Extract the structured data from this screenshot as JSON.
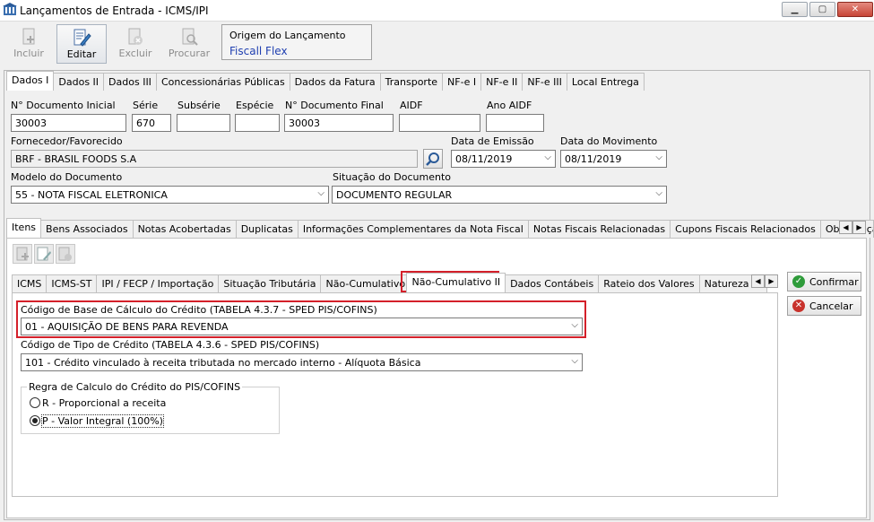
{
  "window": {
    "title": "Lançamentos de Entrada - ICMS/IPI"
  },
  "toolbar": {
    "incluir": "Incluir",
    "editar": "Editar",
    "excluir": "Excluir",
    "procurar": "Procurar"
  },
  "origem": {
    "label": "Origem do Lançamento",
    "value": "Fiscall Flex"
  },
  "main_tabs": [
    "Dados I",
    "Dados II",
    "Dados III",
    "Concessionárias Públicas",
    "Dados da Fatura",
    "Transporte",
    "NF-e I",
    "NF-e II",
    "NF-e III",
    "Local Entrega"
  ],
  "fields": {
    "nro_doc_ini": {
      "label": "N° Documento Inicial",
      "value": "30003"
    },
    "serie": {
      "label": "Série",
      "value": "670"
    },
    "subserie": {
      "label": "Subsérie",
      "value": ""
    },
    "especie": {
      "label": "Espécie",
      "value": ""
    },
    "nro_doc_fin": {
      "label": "N° Documento Final",
      "value": "30003"
    },
    "aidf": {
      "label": "AIDF",
      "value": ""
    },
    "ano_aidf": {
      "label": "Ano AIDF",
      "value": ""
    },
    "fornecedor": {
      "label": "Fornecedor/Favorecido",
      "value": "BRF - BRASIL FOODS S.A"
    },
    "data_emissao": {
      "label": "Data de Emissão",
      "value": "08/11/2019"
    },
    "data_movimento": {
      "label": "Data do Movimento",
      "value": "08/11/2019"
    },
    "modelo": {
      "label": "Modelo do Documento",
      "value": "55 - NOTA FISCAL ELETRONICA"
    },
    "situacao": {
      "label": "Situação do Documento",
      "value": "DOCUMENTO REGULAR"
    }
  },
  "sub_tabs": [
    "Itens",
    "Bens Associados",
    "Notas Acobertadas",
    "Duplicatas",
    "Informações Complementares da Nota Fiscal",
    "Notas Fiscais Relacionadas",
    "Cupons Fiscais Relacionados",
    "Observaçã"
  ],
  "item_tabs": [
    "ICMS",
    "ICMS-ST",
    "IPI / FECP / Importação",
    "Situação Tributária",
    "Não-Cumulativo I",
    "Não-Cumulativo II",
    "Dados Contábeis",
    "Rateio dos Valores",
    "Natureza do R"
  ],
  "nc2": {
    "cod_base_label": "Código de Base de Cálculo do Crédito (TABELA 4.3.7 - SPED PIS/COFINS)",
    "cod_base_value": "01 - AQUISIÇÃO DE BENS PARA REVENDA",
    "cod_tipo_label": "Código de Tipo de Crédito (TABELA 4.3.6 - SPED PIS/COFINS)",
    "cod_tipo_value": "101 - Crédito vinculado à receita tributada no mercado interno - Alíquota Básica",
    "regra_label": "Regra de Calculo do Crédito do PIS/COFINS",
    "radio_r": "R - Proporcional a receita",
    "radio_p": "P - Valor Integral (100%)"
  },
  "actions": {
    "confirmar": "Confirmar",
    "cancelar": "Cancelar"
  },
  "colors": {
    "highlight": "#d4202a",
    "link_blue": "#1f3fb0",
    "confirm_green": "#2e9b3a",
    "cancel_red": "#c8322c"
  }
}
